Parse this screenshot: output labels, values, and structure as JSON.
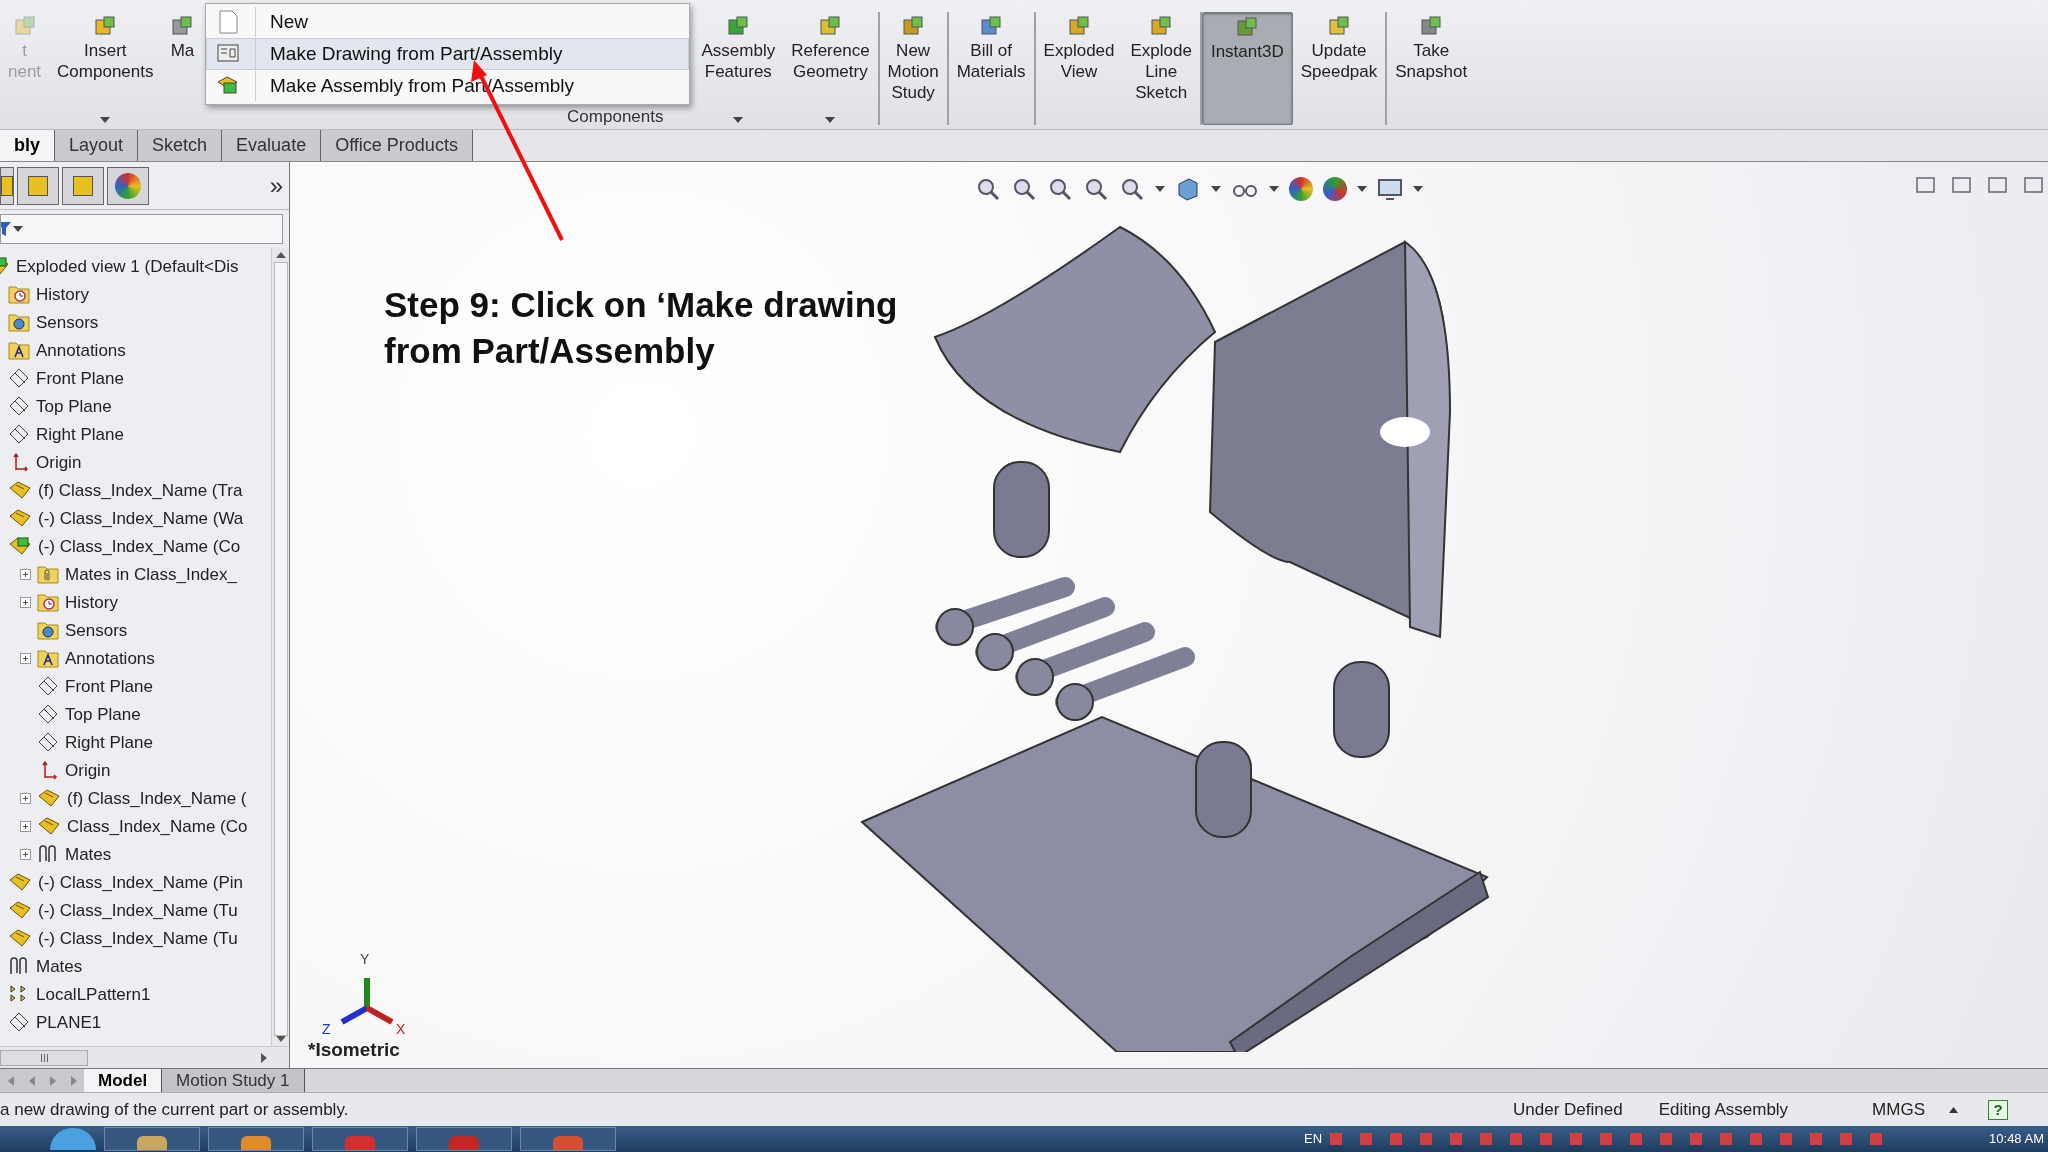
{
  "ribbon": {
    "items": [
      {
        "lines": [
          "t",
          "nent"
        ],
        "kind": "insert",
        "disabled": true,
        "selected": false,
        "dropdown": false,
        "divider_after": false
      },
      {
        "lines": [
          "Insert",
          "Components"
        ],
        "kind": "insert",
        "disabled": false,
        "selected": false,
        "dropdown": true,
        "divider_after": false
      },
      {
        "lines": [
          "Ma"
        ],
        "kind": "mate",
        "disabled": false,
        "selected": false,
        "dropdown": false,
        "divider_after": false
      },
      {
        "lines": [
          "Assembly",
          "Features"
        ],
        "kind": "features",
        "disabled": false,
        "selected": false,
        "dropdown": true,
        "divider_after": false
      },
      {
        "lines": [
          "Reference",
          "Geometry"
        ],
        "kind": "geometry",
        "disabled": false,
        "selected": false,
        "dropdown": true,
        "divider_after": true
      },
      {
        "lines": [
          "New",
          "Motion",
          "Study"
        ],
        "kind": "motion",
        "disabled": false,
        "selected": false,
        "dropdown": false,
        "divider_after": true
      },
      {
        "lines": [
          "Bill of",
          "Materials"
        ],
        "kind": "bom",
        "disabled": false,
        "selected": false,
        "dropdown": false,
        "divider_after": true
      },
      {
        "lines": [
          "Exploded",
          "View"
        ],
        "kind": "explode",
        "disabled": false,
        "selected": false,
        "dropdown": false,
        "divider_after": false
      },
      {
        "lines": [
          "Explode",
          "Line",
          "Sketch"
        ],
        "kind": "explode",
        "disabled": false,
        "selected": false,
        "dropdown": false,
        "divider_after": true
      },
      {
        "lines": [
          "Instant3D"
        ],
        "kind": "instant",
        "disabled": false,
        "selected": true,
        "dropdown": false,
        "divider_after": false
      },
      {
        "lines": [
          "Update",
          "Speedpak"
        ],
        "kind": "speedpak",
        "disabled": false,
        "selected": false,
        "dropdown": false,
        "divider_after": true
      },
      {
        "lines": [
          "Take",
          "Snapshot"
        ],
        "kind": "snapshot",
        "disabled": false,
        "selected": false,
        "dropdown": false,
        "divider_after": false
      }
    ],
    "group_label": "Components"
  },
  "new_menu": {
    "items": [
      {
        "label": "New",
        "kind": "document",
        "selected": false
      },
      {
        "label": "Make Drawing from Part/Assembly",
        "kind": "drawing",
        "selected": true
      },
      {
        "label": "Make Assembly from Part/Assembly",
        "kind": "assembly",
        "selected": false
      }
    ]
  },
  "tabs": [
    {
      "label": "bly",
      "selected": true
    },
    {
      "label": "Layout",
      "selected": false
    },
    {
      "label": "Sketch",
      "selected": false
    },
    {
      "label": "Evaluate",
      "selected": false
    },
    {
      "label": "Office Products",
      "selected": false
    }
  ],
  "panel": {
    "chevron": "»",
    "tree": [
      {
        "label": "Exploded view 1  (Default<Dis",
        "kind": "assembly",
        "children": [
          {
            "label": "History",
            "kind": "history"
          },
          {
            "label": "Sensors",
            "kind": "sensors"
          },
          {
            "label": "Annotations",
            "kind": "annotations"
          },
          {
            "label": "Front Plane",
            "kind": "plane"
          },
          {
            "label": "Top Plane",
            "kind": "plane"
          },
          {
            "label": "Right Plane",
            "kind": "plane"
          },
          {
            "label": "Origin",
            "kind": "origin"
          },
          {
            "label": "(f) Class_Index_Name (Tra",
            "kind": "part"
          },
          {
            "label": "(-) Class_Index_Name (Wa",
            "kind": "part"
          },
          {
            "label": "(-) Class_Index_Name (Co",
            "kind": "subassembly",
            "children": [
              {
                "label": "Mates in Class_Index_",
                "kind": "mates-folder",
                "collapsed": true
              },
              {
                "label": "History",
                "kind": "history",
                "collapsed": true
              },
              {
                "label": "Sensors",
                "kind": "sensors",
                "collapsed": false
              },
              {
                "label": "Annotations",
                "kind": "annotations",
                "collapsed": true
              },
              {
                "label": "Front Plane",
                "kind": "plane",
                "collapsed": false
              },
              {
                "label": "Top Plane",
                "kind": "plane",
                "collapsed": false
              },
              {
                "label": "Right Plane",
                "kind": "plane",
                "collapsed": false
              },
              {
                "label": "Origin",
                "kind": "origin",
                "collapsed": false
              },
              {
                "label": "(f) Class_Index_Name (",
                "kind": "part",
                "collapsed": true
              },
              {
                "label": "Class_Index_Name (Co",
                "kind": "part",
                "collapsed": true
              },
              {
                "label": "Mates",
                "kind": "mates",
                "collapsed": true
              }
            ]
          },
          {
            "label": "(-) Class_Index_Name (Pin",
            "kind": "part"
          },
          {
            "label": "(-) Class_Index_Name (Tu",
            "kind": "part"
          },
          {
            "label": "(-) Class_Index_Name (Tu",
            "kind": "part"
          },
          {
            "label": "Mates",
            "kind": "mates"
          },
          {
            "label": "LocalLPattern1",
            "kind": "pattern"
          },
          {
            "label": "PLANE1",
            "kind": "plane"
          }
        ]
      }
    ]
  },
  "viewport": {
    "annotation": "Step 9: Click on ‘Make drawing from Part/Assembly",
    "view_name": "*Isometric",
    "triad": {
      "x": "X",
      "y": "Y",
      "z": "Z"
    }
  },
  "bottom_tabs": [
    {
      "label": "Model",
      "selected": true
    },
    {
      "label": "Motion Study 1",
      "selected": false
    }
  ],
  "status_bar": {
    "message": "a new drawing of the current part or assembly.",
    "state": "Under Defined",
    "mode": "Editing Assembly",
    "units": "MMGS",
    "help": "?"
  },
  "taskbar": {
    "language": "EN",
    "time": "10:48 AM"
  }
}
